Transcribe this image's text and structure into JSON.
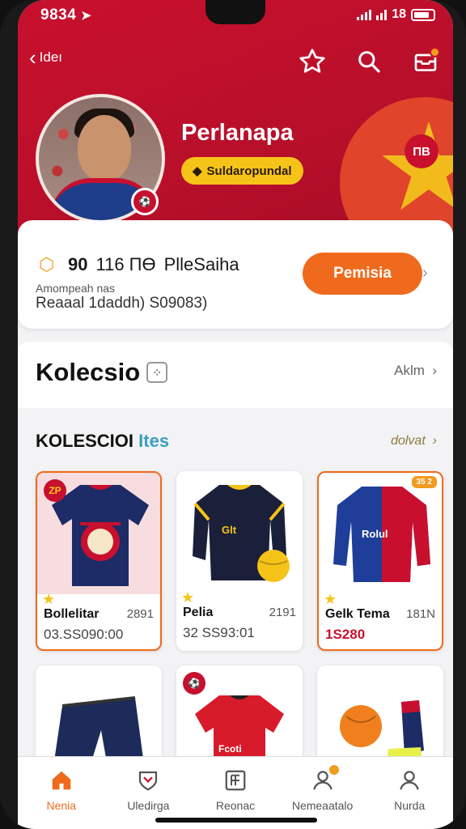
{
  "status": {
    "time": "9834",
    "signal_text": "18"
  },
  "topnav": {
    "back_label": "Ideı"
  },
  "profile": {
    "name": "Perlanapa",
    "pill_label": "Suldaropundal",
    "club_badge_text": "⚽",
    "deco_badge_text": "ПВ"
  },
  "points_card": {
    "points": "90",
    "points_suffix": "116 ПӨ",
    "plan_label": "PlleSaiha",
    "sub1": "Amompeah nas",
    "sub2": "Reaaal 1daddh) S09083)",
    "premium_button": "Pemisia"
  },
  "collection_section": {
    "title": "Kolecsio",
    "link": "Aklm"
  },
  "items_section": {
    "title": "KOLESCIOI",
    "title_accent": "Ites",
    "link": "dolvat"
  },
  "products": [
    {
      "name": "Bollelitar",
      "meta": "2891",
      "price": "03.SS090:00",
      "badge": "ZP"
    },
    {
      "name": "Pelia",
      "meta": "2191",
      "price": "32 SS93:01"
    },
    {
      "name": "Gelk Tema",
      "meta": "181N",
      "price": "1S280",
      "tag": "35 2"
    },
    {
      "name": "",
      "meta": "",
      "price": ""
    },
    {
      "name": "",
      "meta": "",
      "price": "",
      "badge": "⚽"
    },
    {
      "name": "",
      "meta": "",
      "price": ""
    }
  ],
  "bottom_nav": [
    {
      "label": "Nenia",
      "icon": "home-icon"
    },
    {
      "label": "Uledirga",
      "icon": "shield-icon"
    },
    {
      "label": "Reonac",
      "icon": "grid-icon"
    },
    {
      "label": "Nemeaatalo",
      "icon": "user-badge-icon"
    },
    {
      "label": "Nurda",
      "icon": "profile-icon"
    }
  ],
  "colors": {
    "brand_red": "#c8102e",
    "accent_orange": "#ef6a1c",
    "gold": "#f6c418"
  }
}
